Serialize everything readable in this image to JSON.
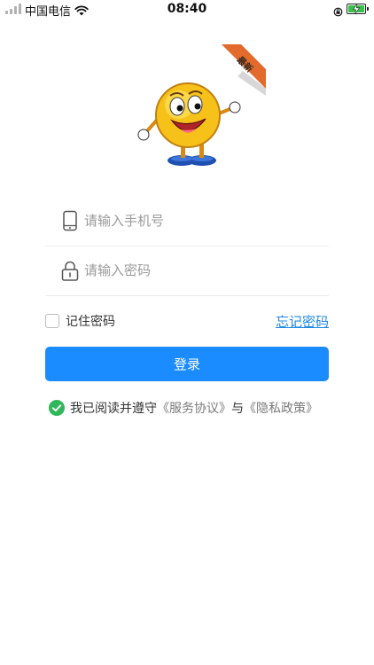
{
  "status_bar": {
    "carrier": "中国电信",
    "time": "08:40"
  },
  "logo": {
    "badge_text": "最新"
  },
  "form": {
    "phone_placeholder": "请输入手机号",
    "password_placeholder": "请输入密码",
    "remember_label": "记住密码",
    "forgot_label": "忘记密码",
    "login_label": "登录"
  },
  "agreement": {
    "prefix": "我已阅读并遵守",
    "service_link": "《服务协议》",
    "conjunction": "与",
    "privacy_link": "《隐私政策》"
  },
  "colors": {
    "primary": "#1a8cff",
    "link": "#1e88e5",
    "check_green": "#2fb85a"
  },
  "icons": {
    "phone": "phone-icon",
    "lock": "lock-icon",
    "agree": "check-circle-icon",
    "wifi": "wifi-icon",
    "battery": "battery-icon",
    "rotation_lock": "rotation-lock-icon"
  }
}
